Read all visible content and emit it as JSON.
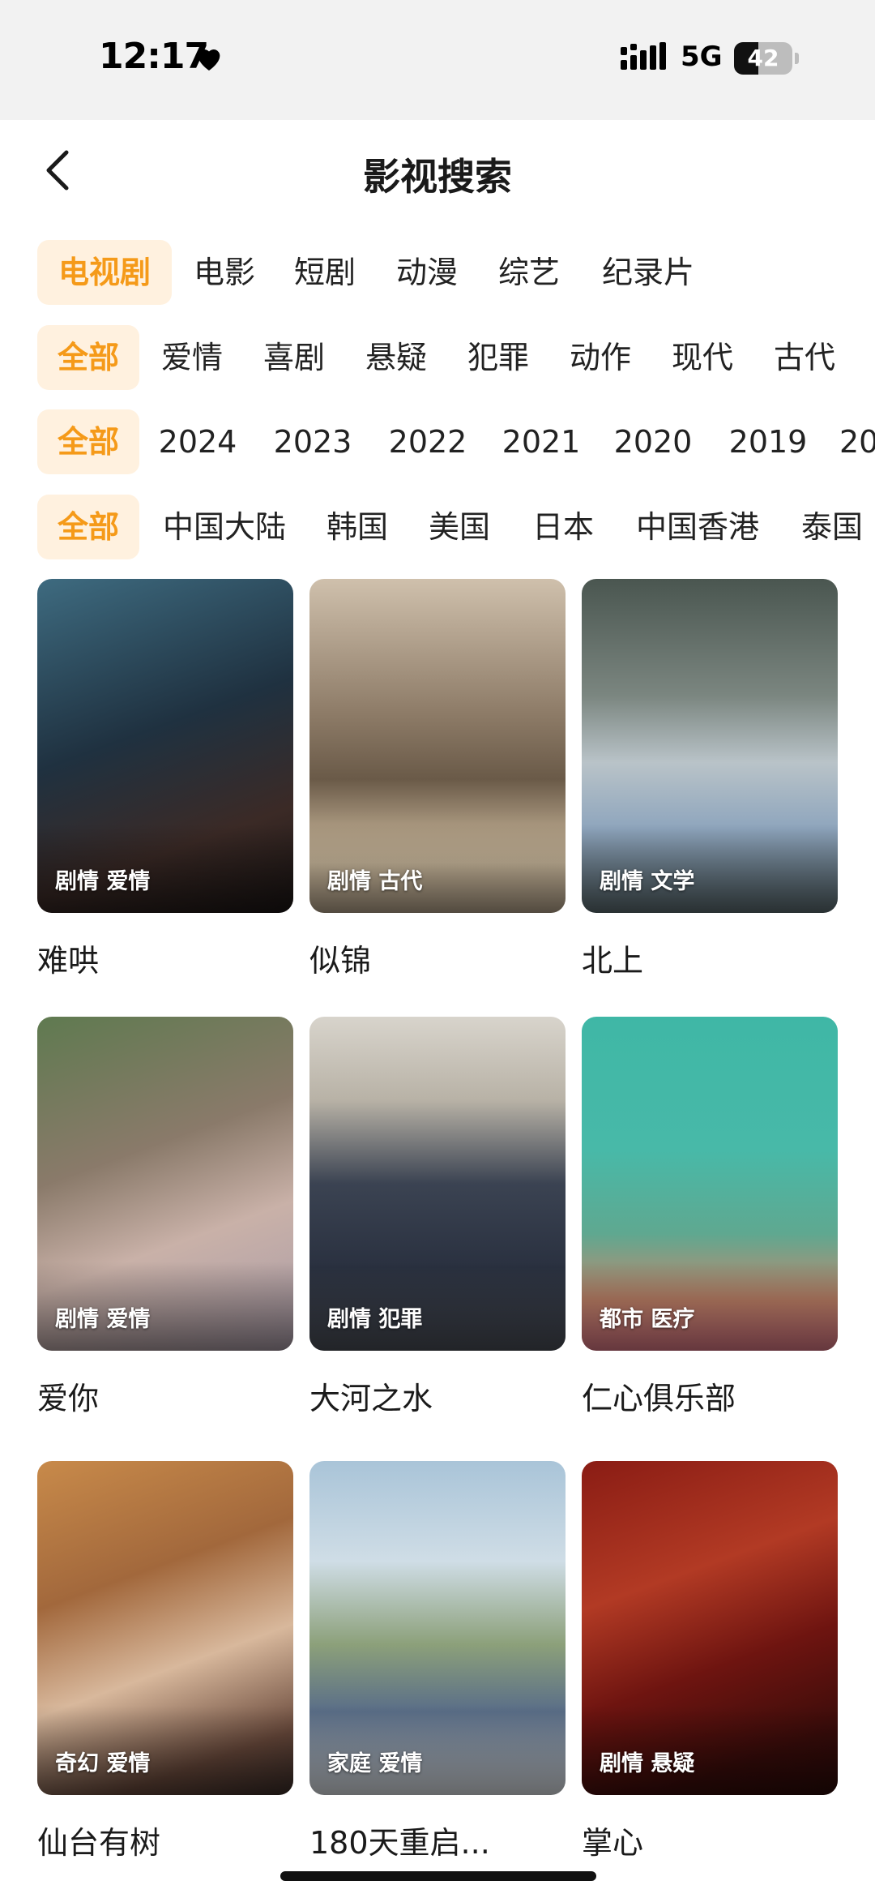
{
  "status_bar": {
    "time": "12:17",
    "network": "5G",
    "battery": "42",
    "battery_level": 0.42
  },
  "nav": {
    "title": "影视搜索"
  },
  "filters": {
    "types": [
      "电视剧",
      "电影",
      "短剧",
      "动漫",
      "综艺",
      "纪录片"
    ],
    "genres": [
      "全部",
      "爱情",
      "喜剧",
      "悬疑",
      "犯罪",
      "动作",
      "现代",
      "古代"
    ],
    "years": [
      "全部",
      "2024",
      "2023",
      "2022",
      "2021",
      "2020",
      "2019",
      "20"
    ],
    "regions": [
      "全部",
      "中国大陆",
      "韩国",
      "美国",
      "日本",
      "中国香港",
      "泰国"
    ],
    "active_color": "#f59a19",
    "active_bg": "#fff1df"
  },
  "items": [
    {
      "title": "难哄",
      "tags": "剧情 爱情"
    },
    {
      "title": "似锦",
      "tags": "剧情 古代"
    },
    {
      "title": "北上",
      "tags": "剧情 文学"
    },
    {
      "title": "爱你",
      "tags": "剧情 爱情"
    },
    {
      "title": "大河之水",
      "tags": "剧情 犯罪"
    },
    {
      "title": "仁心俱乐部",
      "tags": "都市 医疗"
    },
    {
      "title": "仙台有树",
      "tags": "奇幻 爱情"
    },
    {
      "title": "180天重启...",
      "tags": "家庭 爱情"
    },
    {
      "title": "掌心",
      "tags": "剧情 悬疑"
    }
  ]
}
